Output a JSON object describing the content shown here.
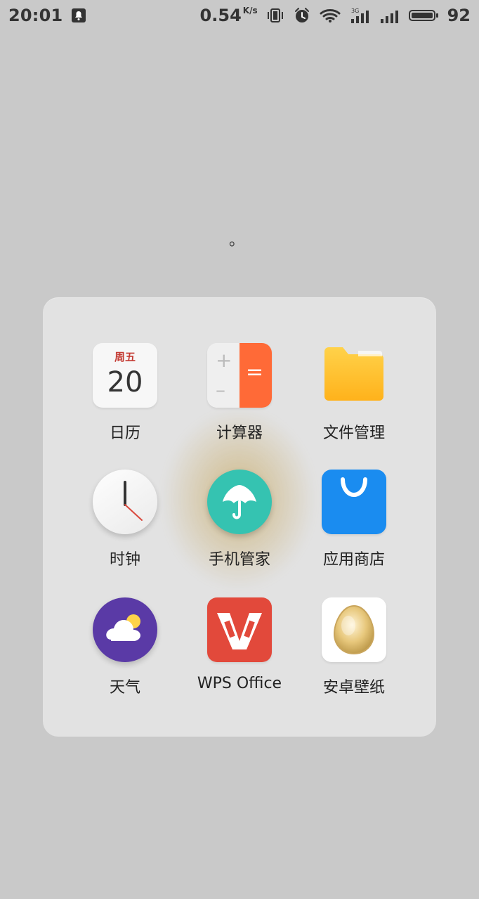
{
  "status_bar": {
    "time": "20:01",
    "network_speed": "0.54",
    "network_unit": "K/s",
    "battery": "92",
    "icons": [
      "notification-icon",
      "vibrate-icon",
      "alarm-icon",
      "wifi-icon",
      "signal-3g-icon",
      "signal-icon",
      "battery-icon"
    ]
  },
  "page": {
    "dot": "。"
  },
  "folder": {
    "apps": [
      {
        "label": "日历",
        "icon": "calendar-icon",
        "calendar_weekday": "周五",
        "calendar_day": "20"
      },
      {
        "label": "计算器",
        "icon": "calculator-icon"
      },
      {
        "label": "文件管理",
        "icon": "folder-icon"
      },
      {
        "label": "时钟",
        "icon": "clock-icon"
      },
      {
        "label": "手机管家",
        "icon": "umbrella-icon"
      },
      {
        "label": "应用商店",
        "icon": "store-bag-icon"
      },
      {
        "label": "天气",
        "icon": "weather-icon"
      },
      {
        "label": "WPS Office",
        "icon": "wps-icon"
      },
      {
        "label": "安卓壁纸",
        "icon": "egg-icon"
      }
    ]
  },
  "colors": {
    "background": "#c9c9c9",
    "folder_bg": "#e6e6e6",
    "accent_orange": "#ff6a37",
    "security_teal": "#35c3b1",
    "store_blue": "#1a8cf0",
    "weather_purple": "#5a3aa6",
    "wps_red": "#e2493b",
    "glow_gold": "#bf973a"
  }
}
